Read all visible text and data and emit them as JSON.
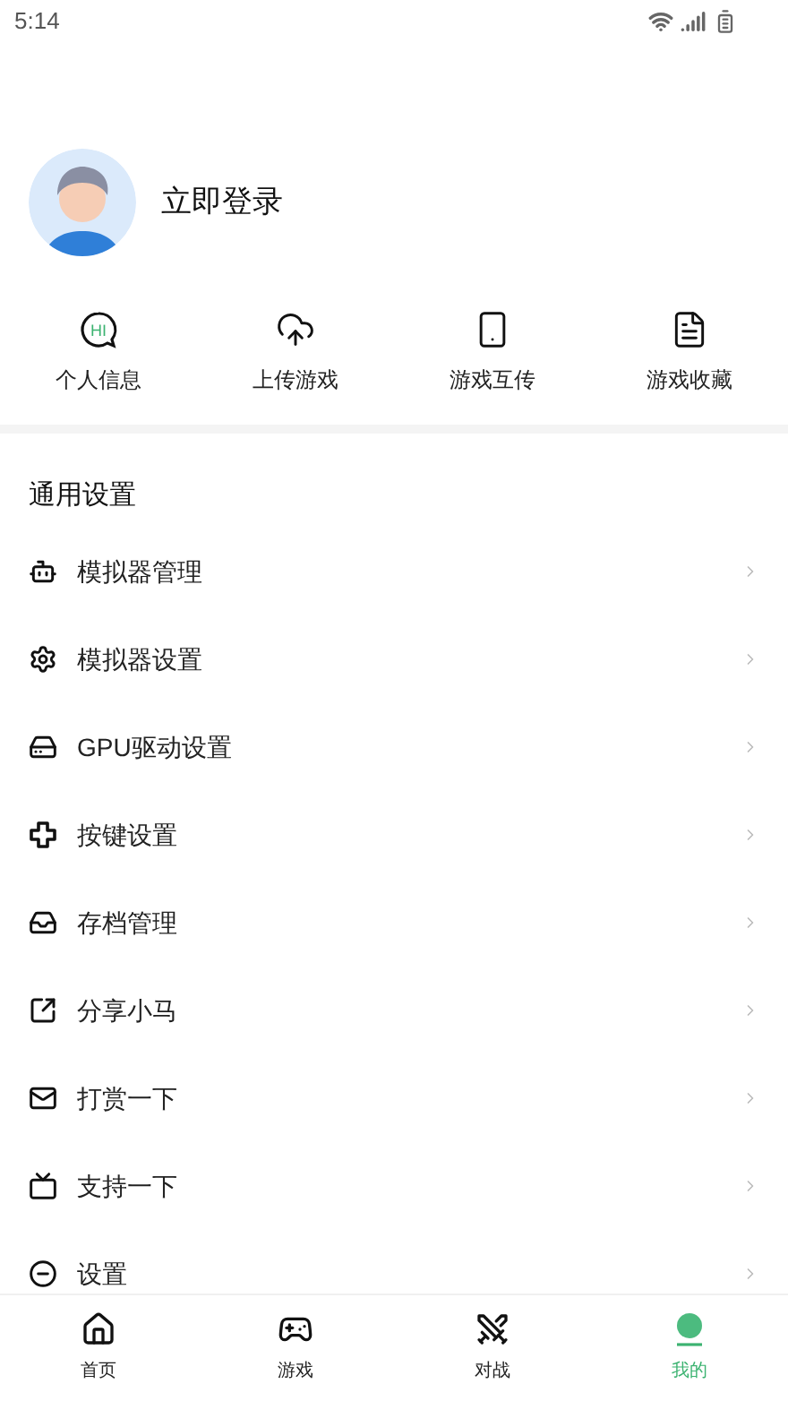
{
  "status_bar": {
    "time": "5:14"
  },
  "profile": {
    "login_label": "立即登录"
  },
  "shortcuts": [
    {
      "label": "个人信息",
      "icon_text": "HI"
    },
    {
      "label": "上传游戏"
    },
    {
      "label": "游戏互传"
    },
    {
      "label": "游戏收藏"
    }
  ],
  "settings": {
    "title": "通用设置",
    "items": [
      {
        "label": "模拟器管理"
      },
      {
        "label": "模拟器设置"
      },
      {
        "label": "GPU驱动设置"
      },
      {
        "label": "按键设置"
      },
      {
        "label": "存档管理"
      },
      {
        "label": "分享小马"
      },
      {
        "label": "打赏一下"
      },
      {
        "label": "支持一下"
      },
      {
        "label": "设置"
      }
    ]
  },
  "bottom_nav": [
    {
      "label": "首页",
      "selected": false
    },
    {
      "label": "游戏",
      "selected": false
    },
    {
      "label": "对战",
      "selected": false
    },
    {
      "label": "我的",
      "selected": true
    }
  ]
}
